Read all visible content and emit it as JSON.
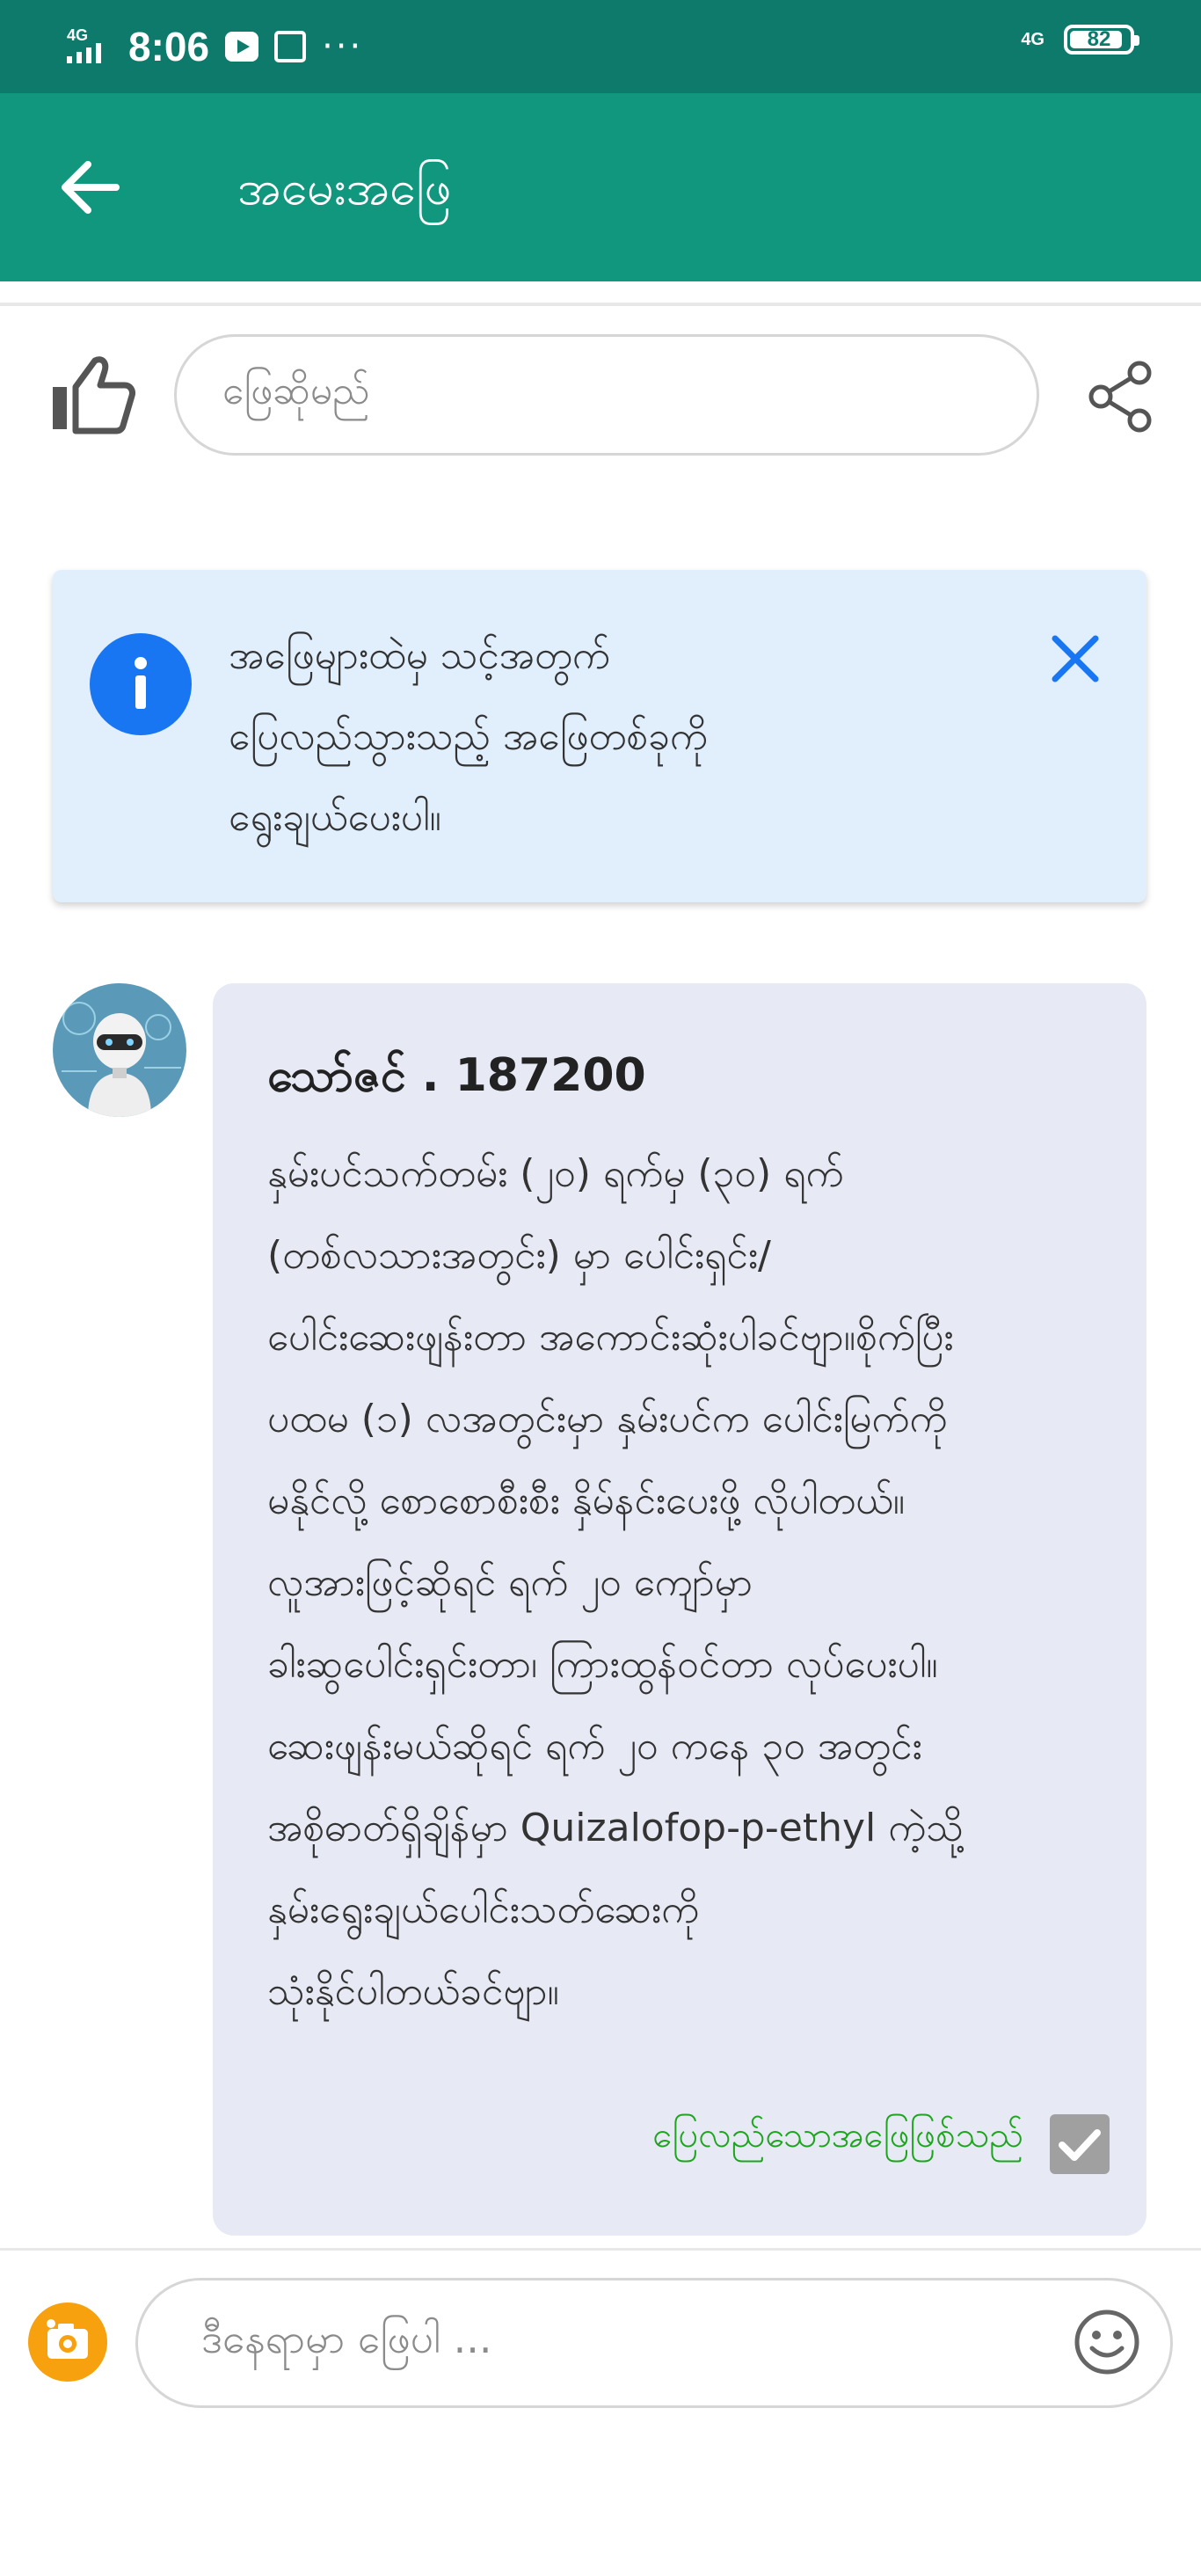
{
  "status_bar": {
    "network": "4G",
    "time": "8:06",
    "more": "···",
    "network_right": "4G",
    "battery": "82"
  },
  "header": {
    "title": "အမေးအဖြေ",
    "color": "#12977f"
  },
  "question_actions": {
    "answer_placeholder": "ဖြေဆိုမည်"
  },
  "info_banner": {
    "lines": [
      "အဖြေများထဲမှ သင့်အတွက်",
      "ပြေလည်သွားသည့် အဖြေတစ်ခုကို",
      "ရွေးချယ်ပေးပါ။"
    ]
  },
  "answer": {
    "author": "သော်ဇင် . 187200",
    "lines": [
      "နှမ်းပင်သက်တမ်း (၂၀) ရက်မှ (၃၀) ရက်",
      "(တစ်လသားအတွင်း) မှာ ပေါင်းရှင်း/",
      "ပေါင်းဆေးဖျန်းတာ အကောင်းဆုံးပါခင်ဗျာ။စိုက်ပြီး",
      "ပထမ (၁) လအတွင်းမှာ နှမ်းပင်က ပေါင်းမြက်ကို",
      "မနိုင်လို့ စောစောစီးစီး နှိမ်နင်းပေးဖို့ လိုပါတယ်။",
      "လူအားဖြင့်ဆိုရင် ရက် ၂၀ ကျော်မှာ",
      "ခါးဆွပေါင်းရှင်းတာ၊ ကြားထွန်ဝင်တာ လုပ်ပေးပါ။",
      "ဆေးဖျန်းမယ်ဆိုရင် ရက် ၂၀ ကနေ ၃၀ အတွင်း",
      "အစိုဓာတ်ရှိချိန်မှာ Quizalofop-p-ethyl ကဲ့သို့",
      "နှမ်းရွေးချယ်ပေါင်းသတ်ဆေးကို",
      "သုံးနိုင်ပါတယ်ခင်ဗျာ။"
    ],
    "accepted_label": "ပြေလည်သောအဖြေဖြစ်သည်",
    "accepted_color": "#1ea51e"
  },
  "reply": {
    "placeholder": "ဒီနေရာမှာ ဖြေပါ ..."
  },
  "icons": [
    "back-arrow-icon",
    "thumbs-up-icon",
    "share-icon",
    "info-icon",
    "close-icon",
    "check-icon",
    "camera-icon",
    "emoji-icon"
  ]
}
